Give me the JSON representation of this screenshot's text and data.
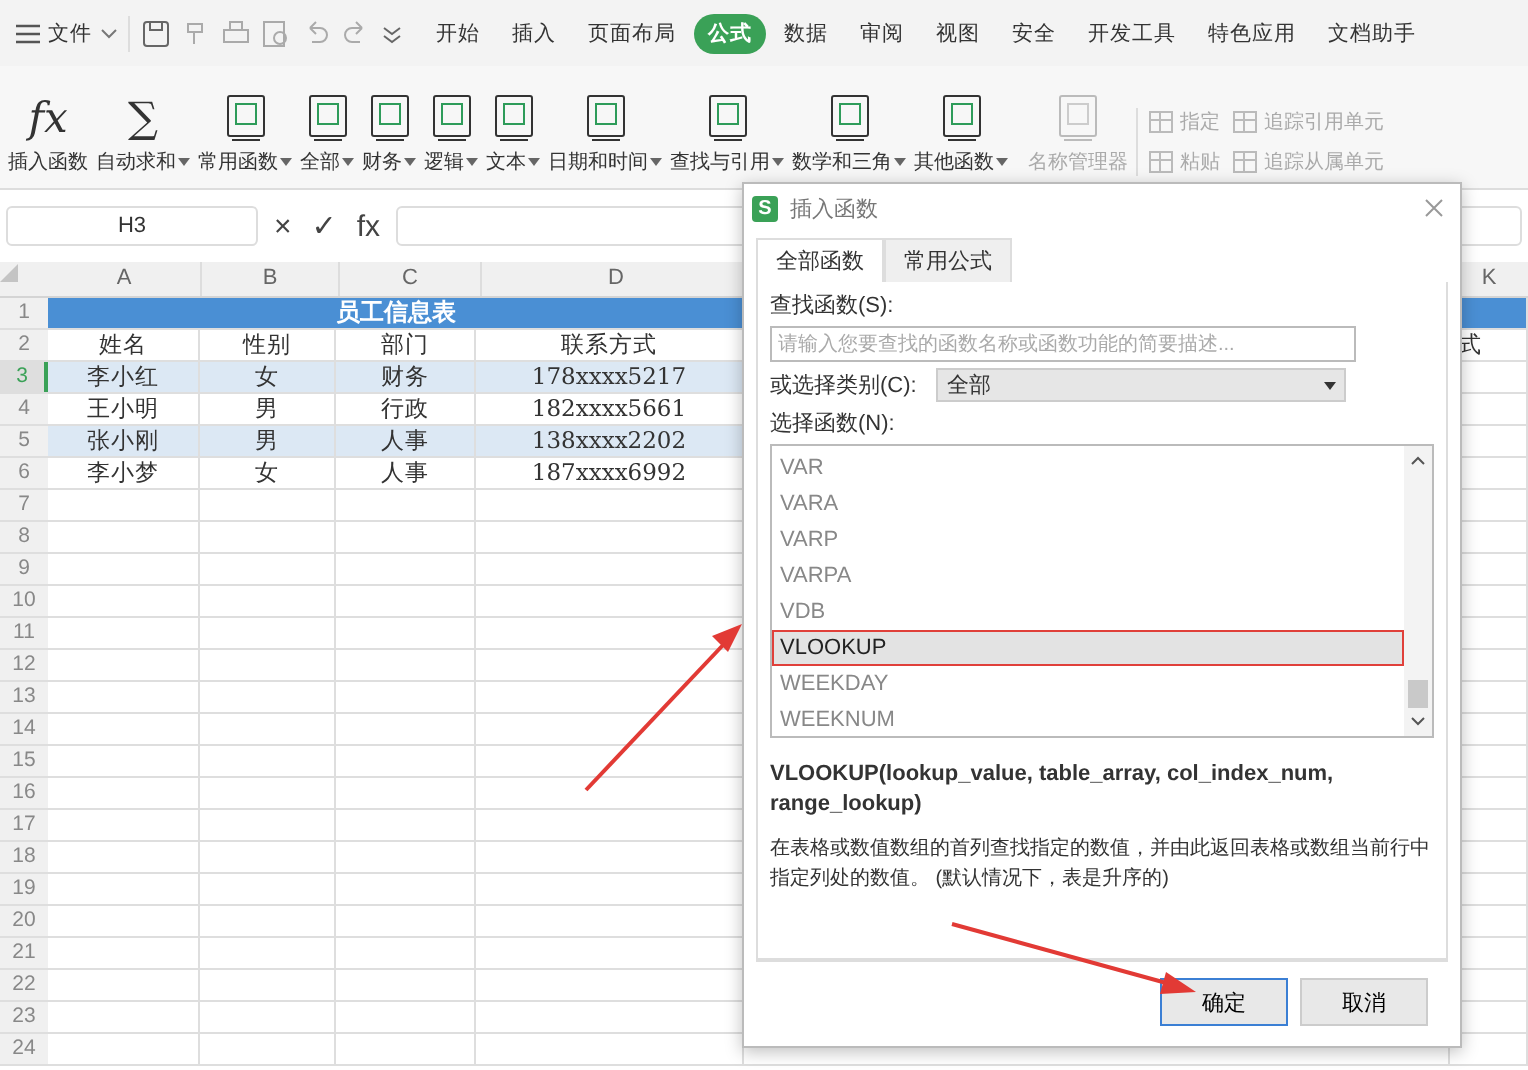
{
  "menu_bar": {
    "file": "文件",
    "tabs": [
      {
        "label": "开始",
        "selected": false
      },
      {
        "label": "插入",
        "selected": false
      },
      {
        "label": "页面布局",
        "selected": false
      },
      {
        "label": "公式",
        "selected": true
      },
      {
        "label": "数据",
        "selected": false
      },
      {
        "label": "审阅",
        "selected": false
      },
      {
        "label": "视图",
        "selected": false
      },
      {
        "label": "安全",
        "selected": false
      },
      {
        "label": "开发工具",
        "selected": false
      },
      {
        "label": "特色应用",
        "selected": false
      },
      {
        "label": "文档助手",
        "selected": false
      }
    ]
  },
  "ribbon": {
    "items": [
      {
        "kind": "glyph",
        "glyph": "fx",
        "label": "插入函数",
        "dropdown": false,
        "disabled": false
      },
      {
        "kind": "glyph",
        "glyph": "∑",
        "label": "自动求和",
        "dropdown": true,
        "disabled": false
      },
      {
        "kind": "book",
        "label": "常用函数",
        "dropdown": true,
        "disabled": false
      },
      {
        "kind": "book",
        "label": "全部",
        "dropdown": true,
        "disabled": false
      },
      {
        "kind": "book",
        "label": "财务",
        "dropdown": true,
        "disabled": false
      },
      {
        "kind": "book",
        "label": "逻辑",
        "dropdown": true,
        "disabled": false
      },
      {
        "kind": "book",
        "label": "文本",
        "dropdown": true,
        "disabled": false
      },
      {
        "kind": "book",
        "label": "日期和时间",
        "dropdown": true,
        "disabled": false
      },
      {
        "kind": "book",
        "label": "查找与引用",
        "dropdown": true,
        "disabled": false
      },
      {
        "kind": "book",
        "label": "数学和三角",
        "dropdown": true,
        "disabled": false
      },
      {
        "kind": "book",
        "label": "其他函数",
        "dropdown": true,
        "disabled": false
      },
      {
        "kind": "book",
        "label": "名称管理器",
        "dropdown": false,
        "disabled": true
      }
    ],
    "small_items": [
      {
        "label": "指定",
        "disabled": true
      },
      {
        "label": "粘贴",
        "disabled": true
      },
      {
        "label": "追踪引用单元",
        "disabled": true
      },
      {
        "label": "追踪从属单元",
        "disabled": true
      }
    ]
  },
  "formula_bar": {
    "cell_ref": "H3",
    "buttons": [
      "×",
      "✓",
      "fx"
    ]
  },
  "sheet": {
    "columns": [
      "A",
      "B",
      "C",
      "D",
      "K"
    ],
    "title": "员工信息表",
    "rows": [
      {
        "number": "1",
        "selected": false,
        "shaded": false,
        "cells": []
      },
      {
        "number": "2",
        "selected": false,
        "shaded": false,
        "cells": [
          "姓名",
          "性别",
          "部门",
          "联系方式"
        ],
        "cell_k": "式"
      },
      {
        "number": "3",
        "selected": true,
        "shaded": true,
        "cells": [
          "李小红",
          "女",
          "财务",
          "178xxxx5217"
        ]
      },
      {
        "number": "4",
        "selected": false,
        "shaded": false,
        "cells": [
          "王小明",
          "男",
          "行政",
          "182xxxx5661"
        ]
      },
      {
        "number": "5",
        "selected": false,
        "shaded": true,
        "cells": [
          "张小刚",
          "男",
          "人事",
          "138xxxx2202"
        ]
      },
      {
        "number": "6",
        "selected": false,
        "shaded": false,
        "cells": [
          "李小梦",
          "女",
          "人事",
          "187xxxx6992"
        ]
      },
      {
        "number": "7",
        "selected": false,
        "shaded": false,
        "cells": []
      },
      {
        "number": "8",
        "selected": false,
        "shaded": false,
        "cells": []
      },
      {
        "number": "9",
        "selected": false,
        "shaded": false,
        "cells": []
      },
      {
        "number": "10",
        "selected": false,
        "shaded": false,
        "cells": []
      },
      {
        "number": "11",
        "selected": false,
        "shaded": false,
        "cells": []
      },
      {
        "number": "12",
        "selected": false,
        "shaded": false,
        "cells": []
      },
      {
        "number": "13",
        "selected": false,
        "shaded": false,
        "cells": []
      },
      {
        "number": "14",
        "selected": false,
        "shaded": false,
        "cells": []
      },
      {
        "number": "15",
        "selected": false,
        "shaded": false,
        "cells": []
      },
      {
        "number": "16",
        "selected": false,
        "shaded": false,
        "cells": []
      },
      {
        "number": "17",
        "selected": false,
        "shaded": false,
        "cells": []
      },
      {
        "number": "18",
        "selected": false,
        "shaded": false,
        "cells": []
      },
      {
        "number": "19",
        "selected": false,
        "shaded": false,
        "cells": []
      },
      {
        "number": "20",
        "selected": false,
        "shaded": false,
        "cells": []
      },
      {
        "number": "21",
        "selected": false,
        "shaded": false,
        "cells": []
      },
      {
        "number": "22",
        "selected": false,
        "shaded": false,
        "cells": []
      },
      {
        "number": "23",
        "selected": false,
        "shaded": false,
        "cells": []
      },
      {
        "number": "24",
        "selected": false,
        "shaded": false,
        "cells": []
      }
    ]
  },
  "dialog": {
    "app_badge": "S",
    "title": "插入函数",
    "tabs": [
      {
        "label": "全部函数",
        "selected": true
      },
      {
        "label": "常用公式",
        "selected": false
      }
    ],
    "search_label": "查找函数(S):",
    "search": {
      "placeholder": "请输入您要查找的函数名称或函数功能的简要描述..."
    },
    "category_label": "或选择类别(C):",
    "category": "全部",
    "list_label": "选择函数(N):",
    "functions": [
      {
        "name": "VAR",
        "selected": false
      },
      {
        "name": "VARA",
        "selected": false
      },
      {
        "name": "VARP",
        "selected": false
      },
      {
        "name": "VARPA",
        "selected": false
      },
      {
        "name": "VDB",
        "selected": false
      },
      {
        "name": "VLOOKUP",
        "selected": true
      },
      {
        "name": "WEEKDAY",
        "selected": false
      },
      {
        "name": "WEEKNUM",
        "selected": false
      }
    ],
    "signature": "VLOOKUP(lookup_value, table_array, col_index_num, range_lookup)",
    "description": "在表格或数值数组的首列查找指定的数值，并由此返回表格或数组当前行中指定列处的数值。 (默认情况下，表是升序的)",
    "buttons": [
      {
        "label": "确定",
        "kind": "primary"
      },
      {
        "label": "取消",
        "kind": "secondary"
      }
    ]
  }
}
